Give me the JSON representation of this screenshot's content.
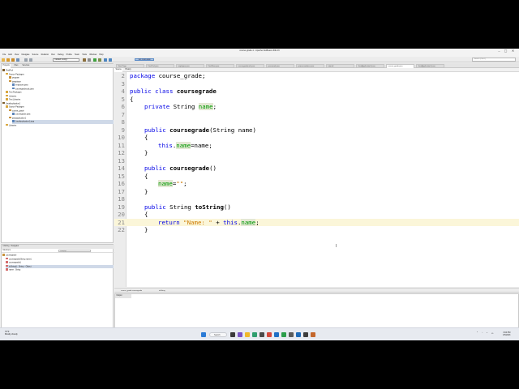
{
  "window": {
    "title": "course-grade-1 - Apache NetBeans IDE 16",
    "min": "–",
    "max": "▢",
    "close": "✕"
  },
  "menu": [
    "File",
    "Edit",
    "View",
    "Navigate",
    "Source",
    "Refactor",
    "Run",
    "Debug",
    "Profile",
    "Team",
    "Tools",
    "Window",
    "Help"
  ],
  "toolbar": {
    "config": "<default config>",
    "memory": "362.1/469.0MB",
    "search_placeholder": "Search (Ctrl+I)"
  },
  "projects_panel": {
    "tabs": [
      "Projects",
      "Files",
      "Services"
    ],
    "tree": [
      {
        "label": "FirstProf",
        "level": 0,
        "icon": "project"
      },
      {
        "label": "Source Packages",
        "level": 1,
        "icon": "folder"
      },
      {
        "label": "program",
        "level": 2,
        "icon": "package"
      },
      {
        "label": "javaplayer",
        "level": 2,
        "icon": "package"
      },
      {
        "label": "employee.java",
        "level": 3,
        "icon": "java"
      },
      {
        "label": "coursegradecalc.java",
        "level": 3,
        "icon": "java"
      },
      {
        "label": "Test Packages",
        "level": 1,
        "icon": "folder"
      },
      {
        "label": "Libraries",
        "level": 1,
        "icon": "folder"
      },
      {
        "label": "Test Libraries",
        "level": 1,
        "icon": "folder"
      },
      {
        "label": "JavaApplication1",
        "level": 0,
        "icon": "project"
      },
      {
        "label": "Source Packages",
        "level": 1,
        "icon": "folder"
      },
      {
        "label": "course_grade",
        "level": 2,
        "icon": "package"
      },
      {
        "label": "coursegrade.java",
        "level": 3,
        "icon": "java"
      },
      {
        "label": "javaapplication1",
        "level": 2,
        "icon": "package"
      },
      {
        "label": "JavaApplication1.java",
        "level": 3,
        "icon": "java",
        "selected": true
      },
      {
        "label": "Libraries",
        "level": 1,
        "icon": "folder"
      }
    ]
  },
  "navigator": {
    "title": "toString - Navigator",
    "members_label": "Members",
    "filter": "<empty>",
    "items": [
      {
        "label": "coursegrade",
        "level": 0
      },
      {
        "label": "coursegrade(String name)",
        "level": 1
      },
      {
        "label": "coursegrade()",
        "level": 1
      },
      {
        "label": "toString() : String ↑ Object",
        "level": 1,
        "selected": true
      },
      {
        "label": "name : String",
        "level": 1
      }
    ]
  },
  "editor_tabs": [
    {
      "label": "Start Page"
    },
    {
      "label": "FirstProf.java"
    },
    {
      "label": "employee.java"
    },
    {
      "label": "FirstFloor.java"
    },
    {
      "label": "coursegradecalc.java"
    },
    {
      "label": "personnel.java"
    },
    {
      "label": "primesnumbers.java"
    },
    {
      "label": "tutor.td"
    },
    {
      "label": "JavaApplication1.java"
    },
    {
      "label": "course_grade.java",
      "active": true
    },
    {
      "label": "JavaApplication1.java"
    }
  ],
  "source_bar": {
    "source": "Source",
    "history": "History"
  },
  "code_lines": [
    {
      "n": "2"
    },
    {
      "n": "3"
    },
    {
      "n": "4"
    },
    {
      "n": "5"
    },
    {
      "n": "6"
    },
    {
      "n": "7"
    },
    {
      "n": "8"
    },
    {
      "n": "9"
    },
    {
      "n": "10"
    },
    {
      "n": "11"
    },
    {
      "n": "12"
    },
    {
      "n": "13"
    },
    {
      "n": "14"
    },
    {
      "n": "15"
    },
    {
      "n": "16"
    },
    {
      "n": "17"
    },
    {
      "n": "18"
    },
    {
      "n": "19"
    },
    {
      "n": "20"
    },
    {
      "n": "21"
    },
    {
      "n": "22"
    }
  ],
  "code": {
    "l2_kw": "package",
    "l2_rest": " course_grade;",
    "l4_kw1": "public",
    "l4_kw2": " class ",
    "l4_id": "coursegrade",
    "brace_open": "{",
    "brace_close": "}",
    "l6_kw": "private",
    "l6_type": " String ",
    "l6_fld": "name",
    "l6_end": ";",
    "l9_kw": "public",
    "l9_id": "coursegrade",
    "l9_params": "(String name)",
    "l11_kw": "this",
    "l11_dot": ".",
    "l11_fld": "name",
    "l11_rest": "=name;",
    "l14_kw": "public",
    "l14_id": "coursegrade",
    "l14_params": "()",
    "l16_fld": "name",
    "l16_eq": "=",
    "l16_str": "\"\"",
    "l16_end": ";",
    "l19_kw": "public",
    "l19_type": " String ",
    "l19_id": "toString",
    "l19_params": "()",
    "l21_kw": "return",
    "l21_str": "\"Name: \"",
    "l21_plus": " + ",
    "l21_this": "this",
    "l21_dot": ".",
    "l21_fld": "name",
    "l21_end": ";"
  },
  "editor_status": {
    "left": "course_grade.coursegrade",
    "right": "toString"
  },
  "output": {
    "title": "Output"
  },
  "status_bar": {
    "position": "21:36",
    "mode": "INS Windows (CRLF)"
  },
  "taskbar": {
    "weather_temp": "70°F",
    "weather_desc": "Mostly cloudy",
    "search": "Search",
    "clock_time": "3:04 PM",
    "clock_date": "1/5/2023"
  },
  "colors": {
    "keyword": "#0000e6",
    "field": "#009900",
    "string": "#ce7b00",
    "highlight_line": "#fbf6d9"
  }
}
